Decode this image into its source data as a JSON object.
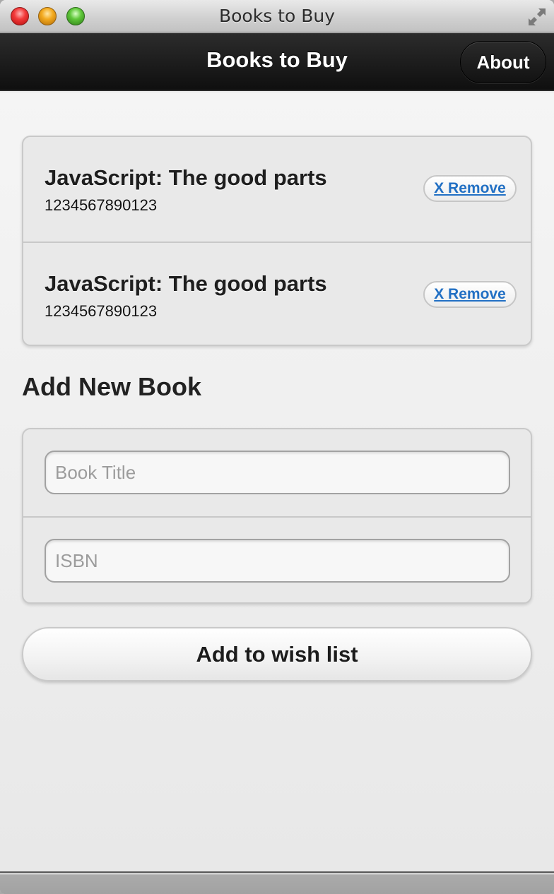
{
  "window": {
    "title": "Books to Buy",
    "controls": [
      "close-icon",
      "minimize-icon",
      "zoom-icon"
    ],
    "fullscreen_icon": "fullscreen-arrows-icon"
  },
  "navbar": {
    "title": "Books to Buy",
    "about_label": "About"
  },
  "books": {
    "items": [
      {
        "title": "JavaScript: The good parts",
        "isbn": "1234567890123",
        "remove_label": "X Remove"
      },
      {
        "title": "JavaScript: The good parts",
        "isbn": "1234567890123",
        "remove_label": "X Remove"
      }
    ]
  },
  "add_section": {
    "heading": "Add New Book",
    "title_field": {
      "placeholder": "Book Title",
      "value": ""
    },
    "isbn_field": {
      "placeholder": "ISBN",
      "value": ""
    },
    "submit_label": "Add to wish list"
  },
  "colors": {
    "link_blue": "#2270c4",
    "navbar_dark": "#1a1a1a"
  }
}
